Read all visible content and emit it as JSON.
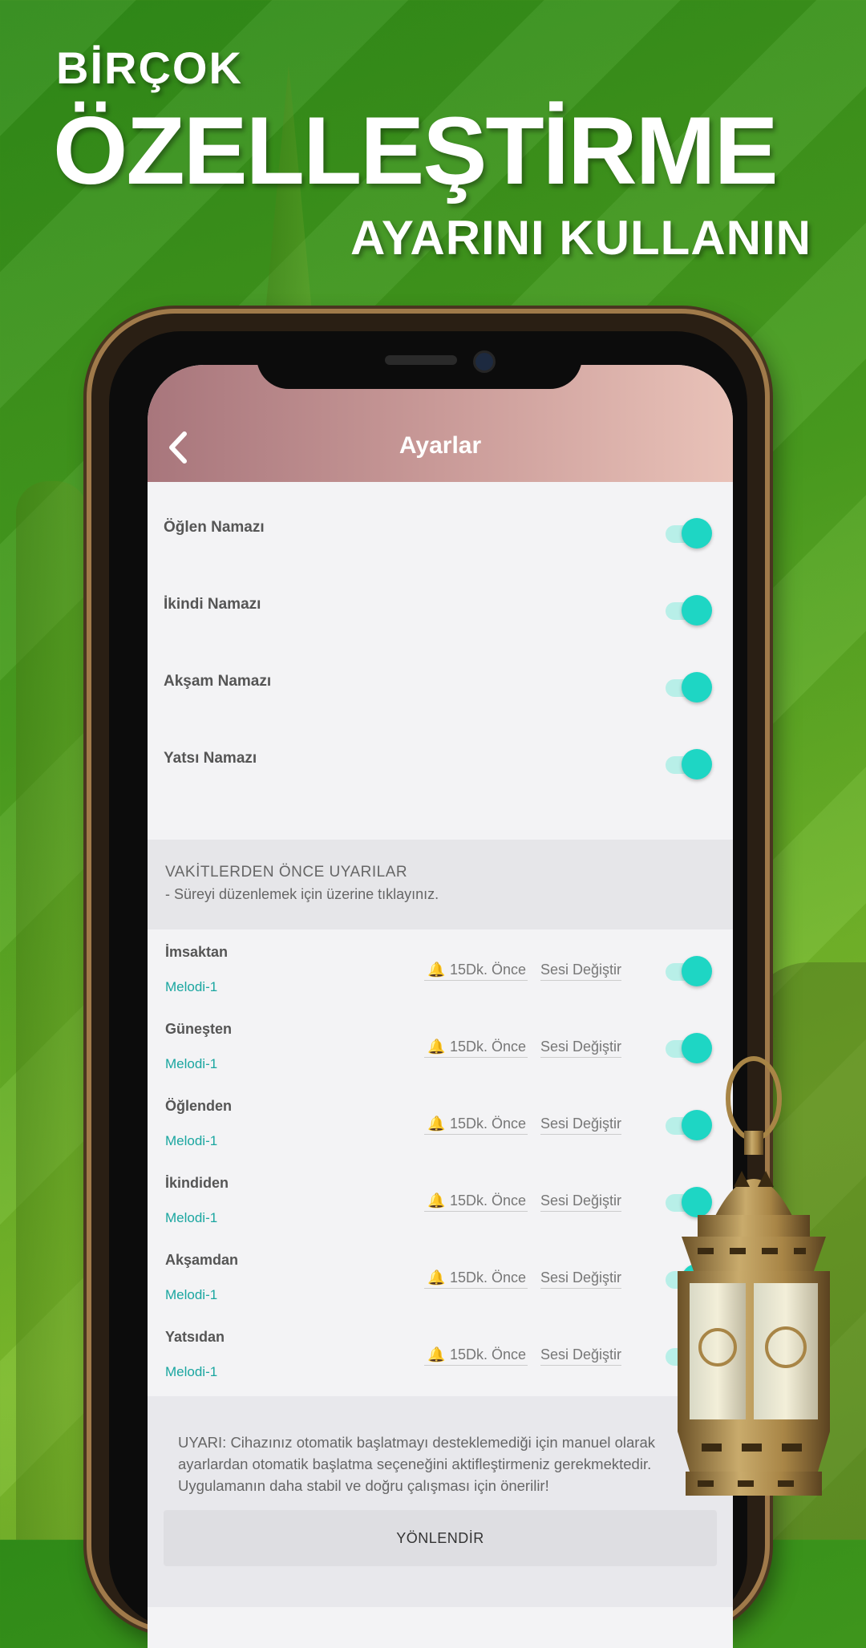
{
  "promo": {
    "line1": "BİRÇOK",
    "line2": "ÖZELLEŞTİRME",
    "line3": "AYARINI KULLANIN"
  },
  "appbar": {
    "title": "Ayarlar",
    "back_icon": "chevron-left-icon"
  },
  "prayers": [
    {
      "label": "Öğlen Namazı",
      "enabled": true
    },
    {
      "label": "İkindi Namazı",
      "enabled": true
    },
    {
      "label": "Akşam Namazı",
      "enabled": true
    },
    {
      "label": "Yatsı Namazı",
      "enabled": true
    }
  ],
  "alerts_section": {
    "title": "VAKİTLERDEN ÖNCE UYARILAR",
    "subtitle": "- Süreyi düzenlemek için üzerine tıklayınız."
  },
  "alerts": [
    {
      "name": "İmsaktan",
      "melody": "Melodi-1",
      "time": "15Dk. Önce",
      "sound": "Sesi Değiştir",
      "enabled": true
    },
    {
      "name": "Güneşten",
      "melody": "Melodi-1",
      "time": "15Dk. Önce",
      "sound": "Sesi Değiştir",
      "enabled": true
    },
    {
      "name": "Öğlenden",
      "melody": "Melodi-1",
      "time": "15Dk. Önce",
      "sound": "Sesi Değiştir",
      "enabled": true
    },
    {
      "name": "İkindiden",
      "melody": "Melodi-1",
      "time": "15Dk. Önce",
      "sound": "Sesi Değiştir",
      "enabled": true
    },
    {
      "name": "Akşamdan",
      "melody": "Melodi-1",
      "time": "15Dk. Önce",
      "sound": "Sesi Değiştir",
      "enabled": true
    },
    {
      "name": "Yatsıdan",
      "melody": "Melodi-1",
      "time": "15Dk. Önce",
      "sound": "Sesi Değiştir",
      "enabled": true
    }
  ],
  "warning": {
    "text": "UYARI: Cihazınız otomatik başlatmayı desteklemediği için manuel olarak ayarlardan otomatik başlatma seçeneğini aktifleştirmeniz gerekmektedir. Uygulamanın daha stabil ve doğru çalışması için önerilir!",
    "button_label": "YÖNLENDİR"
  },
  "colors": {
    "accent": "#1ed6c4",
    "melody": "#1aa6a0",
    "appbar_start": "#a8767c",
    "appbar_end": "#e9c2b8",
    "background_green": "#4a9e1f"
  }
}
